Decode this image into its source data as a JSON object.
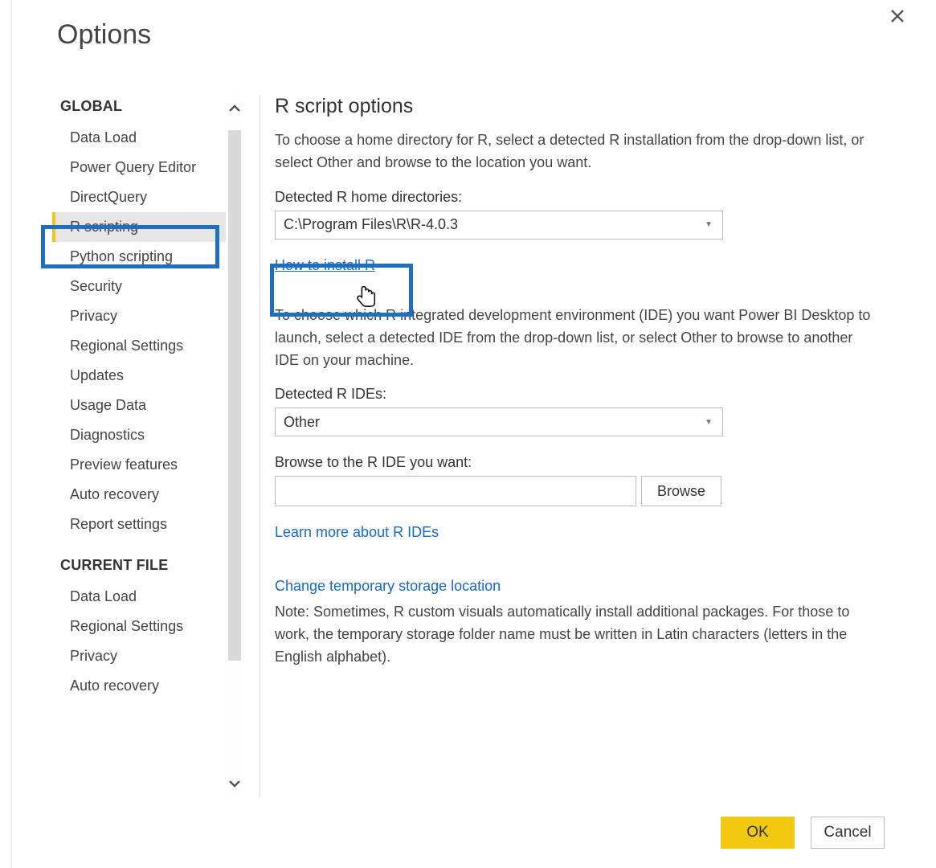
{
  "dialog": {
    "title": "Options"
  },
  "sidebar": {
    "sections": [
      {
        "header": "GLOBAL",
        "items": [
          "Data Load",
          "Power Query Editor",
          "DirectQuery",
          "R scripting",
          "Python scripting",
          "Security",
          "Privacy",
          "Regional Settings",
          "Updates",
          "Usage Data",
          "Diagnostics",
          "Preview features",
          "Auto recovery",
          "Report settings"
        ],
        "selected_index": 3
      },
      {
        "header": "CURRENT FILE",
        "items": [
          "Data Load",
          "Regional Settings",
          "Privacy",
          "Auto recovery"
        ]
      }
    ]
  },
  "main": {
    "heading": "R script options",
    "intro": "To choose a home directory for R, select a detected R installation from the drop-down list, or select Other and browse to the location you want.",
    "detected_home_label": "Detected R home directories:",
    "detected_home_value": "C:\\Program Files\\R\\R-4.0.3",
    "how_to_install_link": "How to install R",
    "ide_intro": "To choose which R integrated development environment (IDE) you want Power BI Desktop to launch, select a detected IDE from the drop-down list, or select Other to browse to another IDE on your machine.",
    "detected_ide_label": "Detected R IDEs:",
    "detected_ide_value": "Other",
    "browse_label": "Browse to the R IDE you want:",
    "browse_button": "Browse",
    "learn_more_link": "Learn more about R IDEs",
    "change_temp_link": "Change temporary storage location",
    "temp_note": "Note: Sometimes, R custom visuals automatically install additional packages. For those to work, the temporary storage folder name must be written in Latin characters (letters in the English alphabet)."
  },
  "footer": {
    "ok": "OK",
    "cancel": "Cancel"
  }
}
